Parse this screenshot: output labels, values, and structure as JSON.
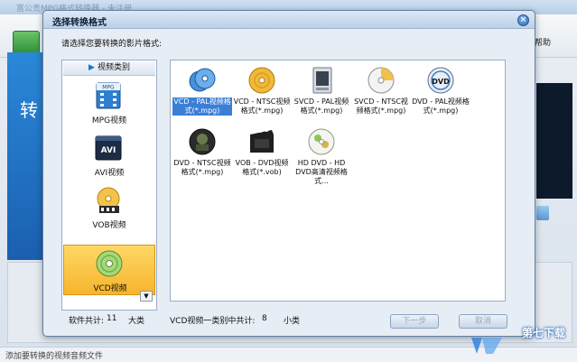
{
  "app": {
    "title": "富公贵MPG格式转换器 - 未注册",
    "help_menu": "帮助",
    "status_text": "添加要转换的视频音频文件",
    "left_banner_char": "转"
  },
  "dialog": {
    "title": "选择转换格式",
    "close_glyph": "×",
    "prompt": "请选择您要转换的影片格式:",
    "category_header": "视频类别",
    "categories": [
      {
        "label": "MPG视频",
        "icon": "mpg-icon"
      },
      {
        "label": "AVI视频",
        "icon": "avi-icon"
      },
      {
        "label": "VOB视频",
        "icon": "vob-icon"
      },
      {
        "label": "VCD视频",
        "icon": "vcd-icon",
        "selected": true
      }
    ],
    "formats": [
      {
        "label": "VCD - PAL视频格式(*.mpg)",
        "icon": "vcd-pal-icon",
        "selected": true
      },
      {
        "label": "VCD - NTSC视频格式(*.mpg)",
        "icon": "vcd-ntsc-icon"
      },
      {
        "label": "SVCD - PAL视频格式(*.mpg)",
        "icon": "svcd-pal-icon"
      },
      {
        "label": "SVCD - NTSC视频格式(*.mpg)",
        "icon": "svcd-ntsc-icon"
      },
      {
        "label": "DVD - PAL视频格式(*.mpg)",
        "icon": "dvd-pal-icon"
      },
      {
        "label": "DVD - NTSC视频格式(*.mpg)",
        "icon": "dvd-ntsc-icon"
      },
      {
        "label": "VOB - DVD视频格式(*.vob)",
        "icon": "vob-dvd-icon"
      },
      {
        "label": "HD DVD - HD DVD高清视频格式...",
        "icon": "hd-dvd-icon"
      }
    ],
    "footer": {
      "software_total_label": "软件共计:",
      "software_total_value": "11",
      "software_total_unit": "大类",
      "category_total_label": "VCD视频一类别中共计:",
      "category_total_value": "8",
      "category_total_unit": "小类"
    },
    "buttons": {
      "next": "下一步",
      "cancel": "取消"
    }
  },
  "watermark": {
    "text": "第七下载"
  }
}
